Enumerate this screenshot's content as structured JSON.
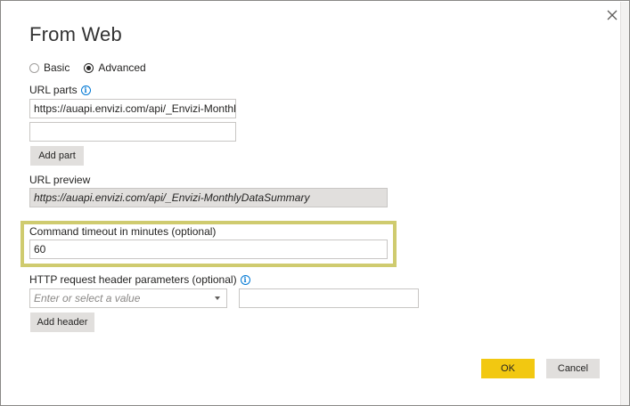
{
  "dialog": {
    "title": "From Web",
    "close_label": "×"
  },
  "mode": {
    "options": [
      {
        "label": "Basic",
        "selected": false
      },
      {
        "label": "Advanced",
        "selected": true
      }
    ]
  },
  "url_parts": {
    "label": "URL parts",
    "part1_value": "https://auapi.envizi.com/api/_Envizi-MonthlyDataSummary",
    "part2_value": "",
    "add_part_label": "Add part"
  },
  "url_preview": {
    "label": "URL preview",
    "value": "https://auapi.envizi.com/api/_Envizi-MonthlyDataSummary"
  },
  "timeout": {
    "label": "Command timeout in minutes (optional)",
    "value": "60"
  },
  "headers": {
    "label": "HTTP request header parameters (optional)",
    "name_placeholder": "Enter or select a value",
    "value_value": "",
    "add_header_label": "Add header"
  },
  "footer": {
    "ok_label": "OK",
    "cancel_label": "Cancel"
  },
  "colors": {
    "accent_yellow": "#f2c811",
    "highlight_border": "#cfcb6f",
    "info_blue": "#0078d4"
  },
  "icons": {
    "close": "close-icon",
    "info": "info-icon",
    "dropdown": "chevron-down-icon"
  }
}
